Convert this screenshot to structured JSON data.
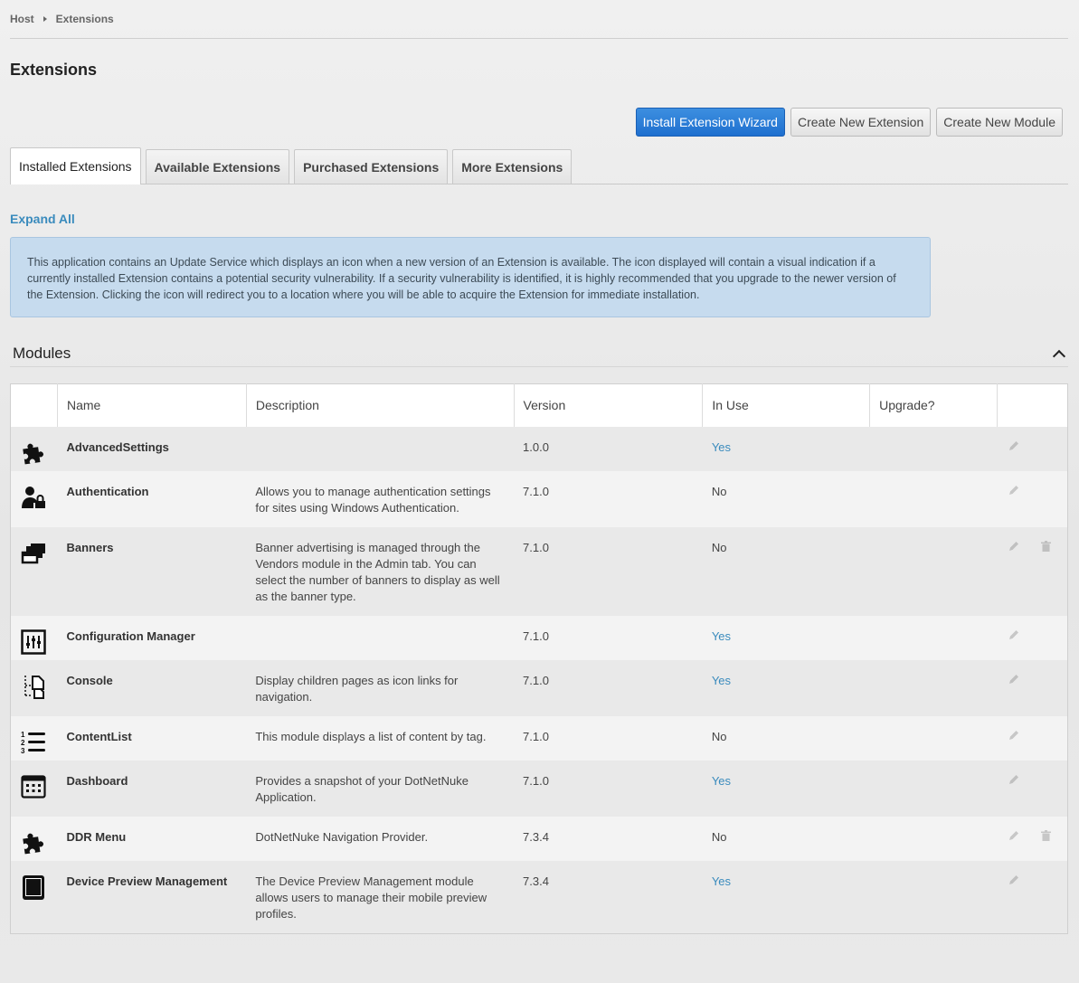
{
  "breadcrumb": {
    "root": "Host",
    "current": "Extensions"
  },
  "page_title": "Extensions",
  "actions": {
    "wizard": "Install Extension Wizard",
    "create_extension": "Create New Extension",
    "create_module": "Create New Module"
  },
  "tabs": [
    {
      "label": "Installed Extensions"
    },
    {
      "label": "Available Extensions"
    },
    {
      "label": "Purchased Extensions"
    },
    {
      "label": "More Extensions"
    }
  ],
  "expand_all": "Expand All",
  "info_text": "This application contains an Update Service which displays an icon when a new version of an Extension is available. The icon displayed will contain a visual indication if a currently installed Extension contains a potential security vulnerability. If a security vulnerability is identified, it is highly recommended that you upgrade to the newer version of the Extension. Clicking the icon will redirect you to a location where you will be able to acquire the Extension for immediate installation.",
  "section_title": "Modules",
  "columns": {
    "name": "Name",
    "description": "Description",
    "version": "Version",
    "in_use": "In Use",
    "upgrade": "Upgrade?"
  },
  "modules": [
    {
      "icon": "puzzle-icon",
      "name": "AdvancedSettings",
      "description": "",
      "version": "1.0.0",
      "in_use": "Yes",
      "deletable": false
    },
    {
      "icon": "user-lock-icon",
      "name": "Authentication",
      "description": "Allows you to manage authentication settings for sites using Windows Authentication.",
      "version": "7.1.0",
      "in_use": "No",
      "deletable": false
    },
    {
      "icon": "stacked-windows-icon",
      "name": "Banners",
      "description": "Banner advertising is managed through the Vendors module in the Admin tab. You can select the number of banners to display as well as the banner type.",
      "version": "7.1.0",
      "in_use": "No",
      "deletable": true
    },
    {
      "icon": "sliders-icon",
      "name": "Configuration Manager",
      "description": "",
      "version": "7.1.0",
      "in_use": "Yes",
      "deletable": false
    },
    {
      "icon": "sitemap-pages-icon",
      "name": "Console",
      "description": "Display children pages as icon links for navigation.",
      "version": "7.1.0",
      "in_use": "Yes",
      "deletable": false
    },
    {
      "icon": "numbered-list-icon",
      "name": "ContentList",
      "description": "This module displays a list of content by tag.",
      "version": "7.1.0",
      "in_use": "No",
      "deletable": false
    },
    {
      "icon": "calendar-grid-icon",
      "name": "Dashboard",
      "description": "Provides a snapshot of your DotNetNuke Application.",
      "version": "7.1.0",
      "in_use": "Yes",
      "deletable": false
    },
    {
      "icon": "puzzle-icon",
      "name": "DDR Menu",
      "description": "DotNetNuke Navigation Provider.",
      "version": "7.3.4",
      "in_use": "No",
      "deletable": true
    },
    {
      "icon": "tablet-icon",
      "name": "Device Preview Management",
      "description": "The Device Preview Management module allows users to manage their mobile preview profiles.",
      "version": "7.3.4",
      "in_use": "Yes",
      "deletable": false
    }
  ],
  "colors": {
    "link": "#3a8bbd",
    "primary_button": "#2a7ad6",
    "info_bg": "#c6dbee"
  }
}
